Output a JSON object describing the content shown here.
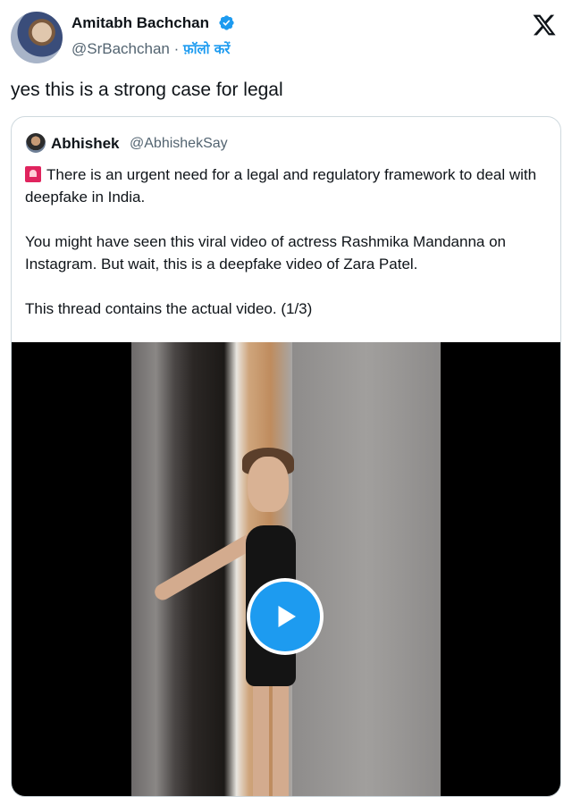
{
  "tweet": {
    "author": {
      "name": "Amitabh Bachchan",
      "handle": "@SrBachchan",
      "separator": "·",
      "follow_label": "फ़ॉलो करें",
      "verified": true
    },
    "text": "yes this is a strong case for legal",
    "brand_icon": "x-logo-icon"
  },
  "quote": {
    "author": {
      "name": "Abhishek",
      "handle": "@AbhishekSay"
    },
    "lines": [
      "There is an urgent need for a legal and regulatory framework to deal with deepfake in India.",
      "You might have seen this viral video of actress Rashmika Mandanna on Instagram. But wait, this is a deepfake video of Zara Patel.",
      "This thread contains the actual video.  (1/3)"
    ],
    "lead_icon": "siren-icon",
    "media": {
      "type": "video",
      "control_icon": "play-icon"
    }
  },
  "colors": {
    "accent": "#1d9bf0",
    "text": "#0f1419",
    "muted": "#536471",
    "border": "#cfd9de"
  }
}
